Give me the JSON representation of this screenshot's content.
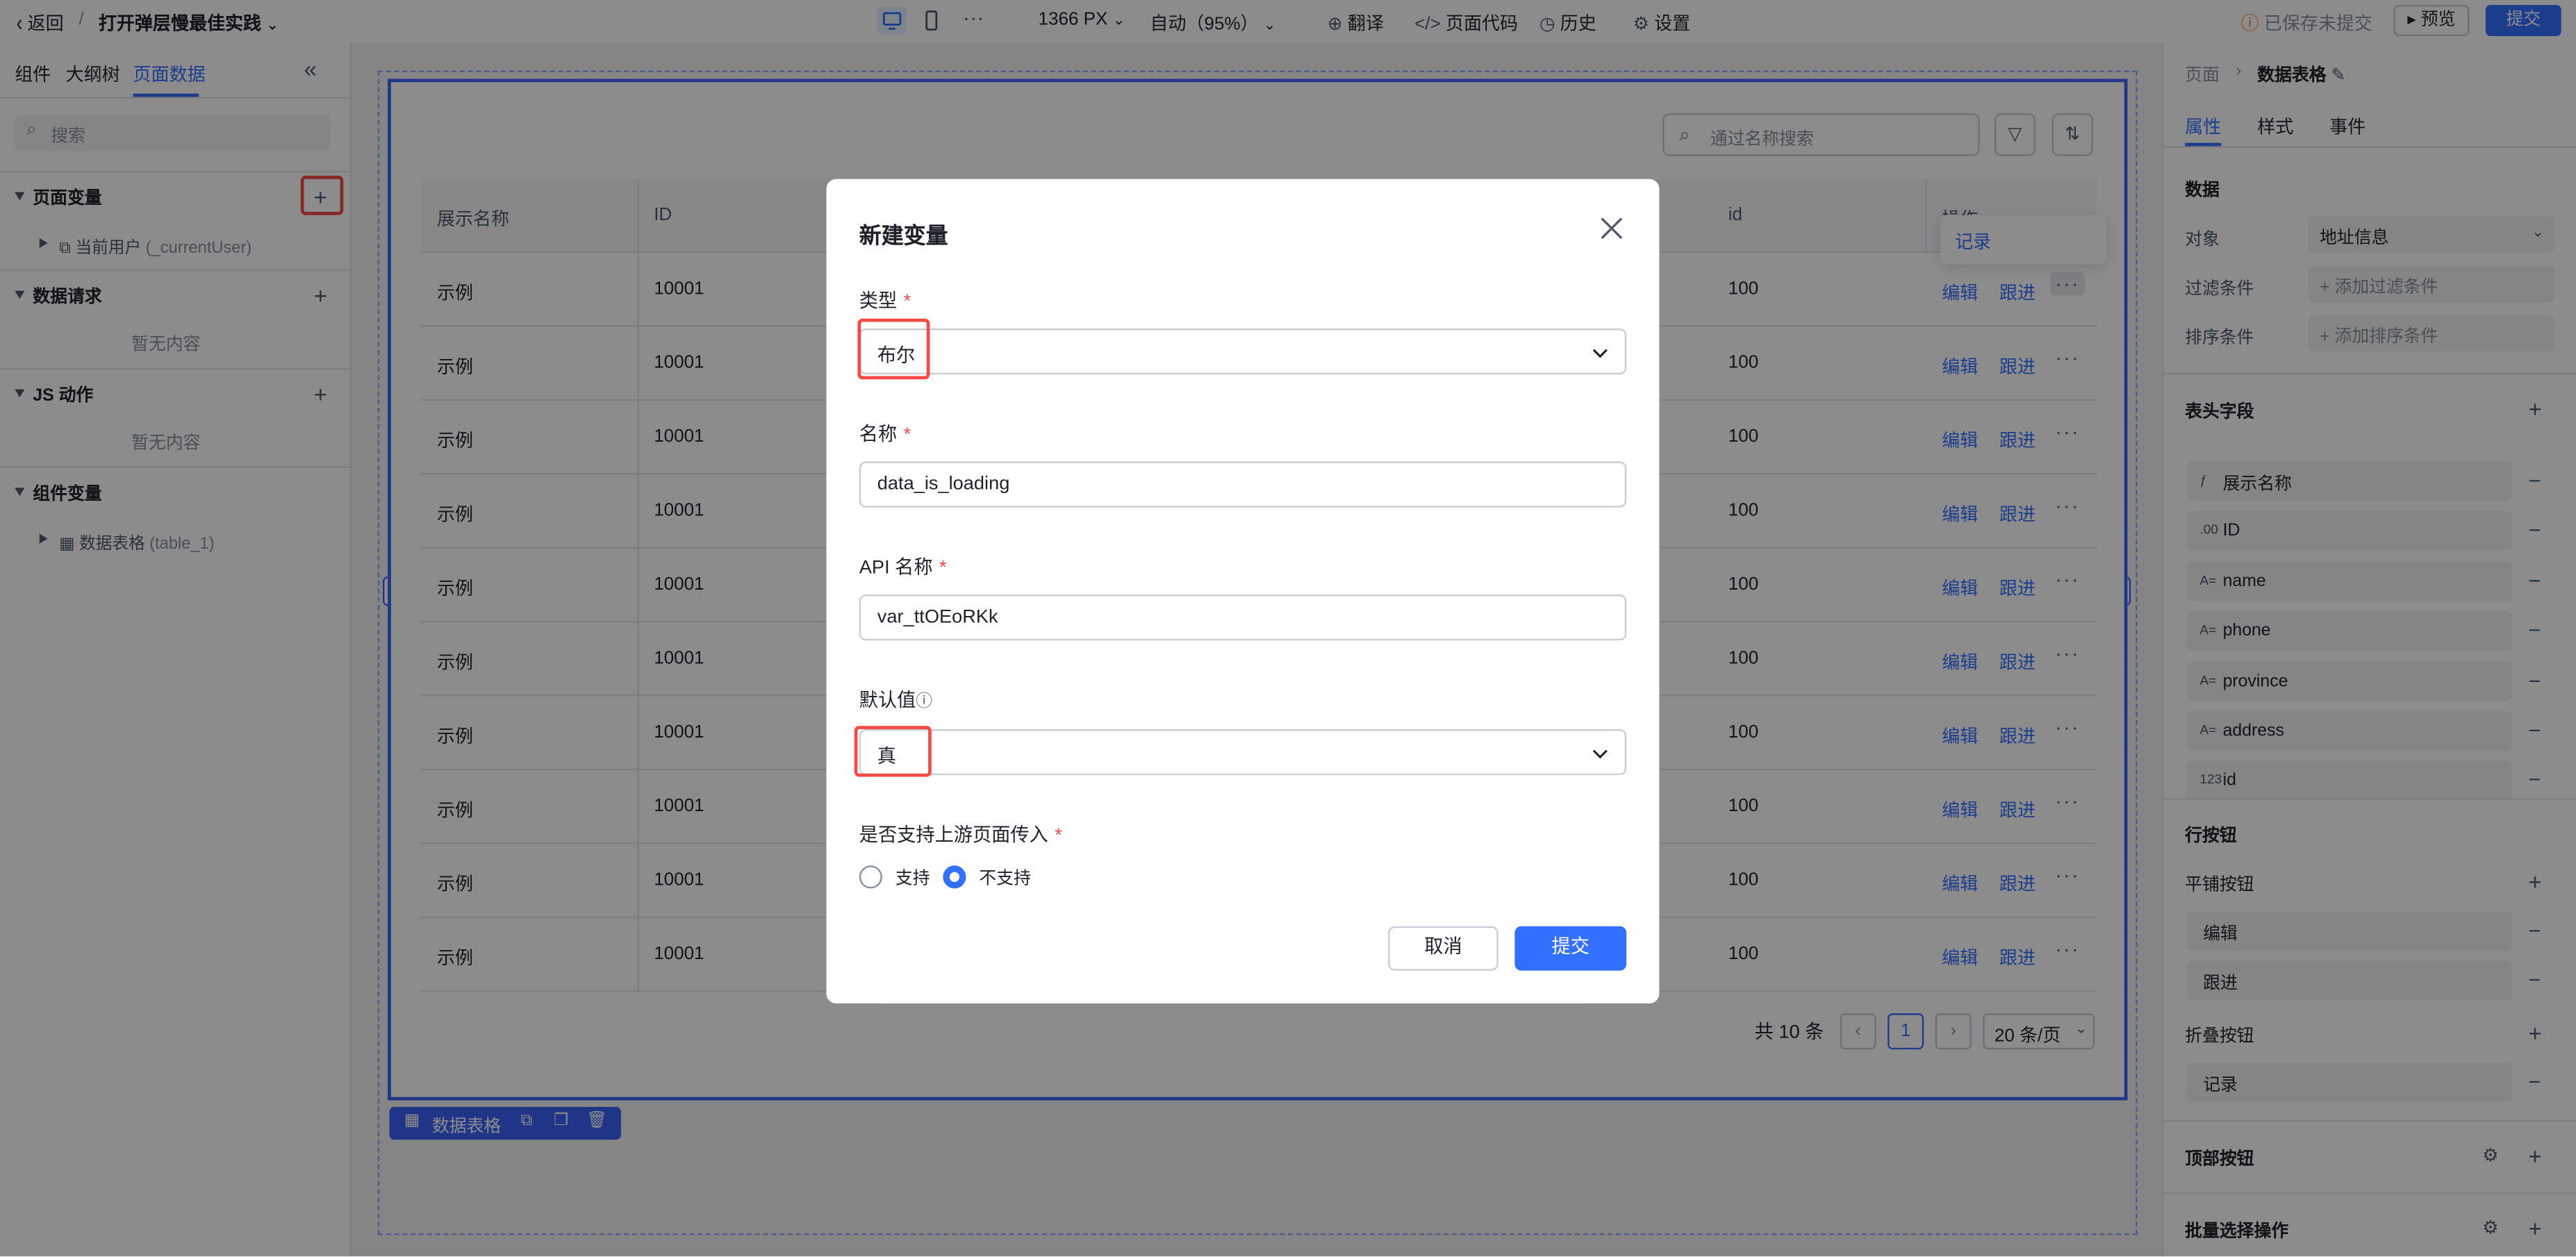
{
  "topbar": {
    "back": "返回",
    "sep": "/",
    "title": "打开弹层慢最佳实践",
    "width": "1366 PX",
    "zoom": "自动（95%）",
    "translate": "翻译",
    "page_code": "页面代码",
    "history": "历史",
    "settings": "设置",
    "save_status": "已保存未提交",
    "preview": "预览",
    "submit": "提交"
  },
  "left": {
    "tabs": [
      "组件",
      "大纲树",
      "页面数据"
    ],
    "search_placeholder": "搜索",
    "sections": {
      "page_vars": "页面变量",
      "current_user": "当前用户",
      "current_user_id": "(_currentUser)",
      "data_requests": "数据请求",
      "data_requests_empty": "暂无内容",
      "js_actions": "JS 动作",
      "js_actions_empty": "暂无内容",
      "component_vars": "组件变量",
      "data_table": "数据表格",
      "data_table_id": "(table_1)"
    }
  },
  "canvas": {
    "search_placeholder": "通过名称搜索",
    "columns": [
      "展示名称",
      "ID",
      "id",
      "操作"
    ],
    "rows": [
      {
        "name": "示例",
        "id": "10001",
        "id2": "100"
      },
      {
        "name": "示例",
        "id": "10001",
        "id2": "100"
      },
      {
        "name": "示例",
        "id": "10001",
        "id2": "100"
      },
      {
        "name": "示例",
        "id": "10001",
        "id2": "100"
      },
      {
        "name": "示例",
        "id": "10001",
        "id2": "100"
      },
      {
        "name": "示例",
        "id": "10001",
        "id2": "100"
      },
      {
        "name": "示例",
        "id": "10001",
        "id2": "100"
      },
      {
        "name": "示例",
        "id": "10001",
        "id2": "100"
      },
      {
        "name": "示例",
        "id": "10001",
        "id2": "100"
      },
      {
        "name": "示例",
        "id": "10001",
        "id2": "100"
      }
    ],
    "row_actions": {
      "edit": "编辑",
      "follow": "跟进",
      "more": "···"
    },
    "dropdown_record": "记录",
    "total": "共 10 条",
    "page": "1",
    "page_size": "20 条/页",
    "component_tag": "数据表格"
  },
  "modal": {
    "title": "新建变量",
    "type_label": "类型",
    "type_value": "布尔",
    "name_label": "名称",
    "name_value": "data_is_loading",
    "api_label": "API 名称",
    "api_value": "var_ttOEoRKk",
    "default_label": "默认值",
    "default_value": "真",
    "upstream_label": "是否支持上游页面传入",
    "opt_support": "支持",
    "opt_not_support": "不支持",
    "selected_option": "不支持",
    "required_mark": "*",
    "cancel": "取消",
    "submit": "提交"
  },
  "right": {
    "crumb_page": "页面",
    "crumb_current": "数据表格",
    "tabs": [
      "属性",
      "样式",
      "事件"
    ],
    "data_title": "数据",
    "object_label": "对象",
    "object_value": "地址信息",
    "filter_label": "过滤条件",
    "filter_add": "添加过滤条件",
    "sort_label": "排序条件",
    "sort_add": "添加排序条件",
    "header_fields": "表头字段",
    "fields": [
      {
        "badge": "ƒ",
        "name": "展示名称"
      },
      {
        "badge": ".00",
        "name": "ID"
      },
      {
        "badge": "A=",
        "name": "name"
      },
      {
        "badge": "A=",
        "name": "phone"
      },
      {
        "badge": "A=",
        "name": "province"
      },
      {
        "badge": "A=",
        "name": "address"
      },
      {
        "badge": "123",
        "name": "id"
      }
    ],
    "row_buttons": "行按钮",
    "tile_buttons": "平铺按钮",
    "tile_items": [
      "编辑",
      "跟进"
    ],
    "fold_buttons": "折叠按钮",
    "fold_items": [
      "记录"
    ],
    "top_buttons": "顶部按钮",
    "batch_ops": "批量选择操作"
  },
  "colors": {
    "accent": "#3370ff",
    "highlight": "#f54a45",
    "warning": "#ff7d00"
  }
}
